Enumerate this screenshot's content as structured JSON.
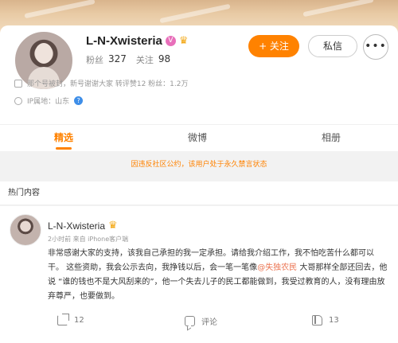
{
  "profile": {
    "username": "L-N-Xwisteria",
    "verified_badge": "V",
    "fans_label": "粉丝",
    "fans_count": "327",
    "following_label": "关注",
    "following_count": "98",
    "follow_button": "+ 关注",
    "message_button": "私信",
    "more_button": "•••",
    "info_line": "那个号被封，新号谢谢大家  转评赞12  粉丝：1.2万",
    "ip_location": "IP属地：山东",
    "help_icon": "?"
  },
  "tabs": [
    {
      "label": "精选",
      "active": true
    },
    {
      "label": "微博",
      "active": false
    },
    {
      "label": "相册",
      "active": false
    }
  ],
  "notice": "因违反社区公约，该用户处于永久禁言状态",
  "section_title": "热门内容",
  "post": {
    "author": "L-N-Xwisteria",
    "meta": "2小时前  来自 iPhone客户端",
    "text_before": "非常感谢大家的支持，该我自己承担的我一定承担。请给我介绍工作，我不怕吃苦什么都可以干。 这些资助，我会公示去向，我挣钱以后，会一笔一笔像",
    "mention": "@失独农民",
    "text_after": " 大哥那样全部还回去，他说 “谁的钱也不是大风刮来的”，他一个失去儿子的民工都能做到，我受过教育的人，没有理由放弃尊严，也要做到。",
    "share_count": "12",
    "comment_label": "评论",
    "like_count": "13"
  },
  "colors": {
    "accent": "#ff8200",
    "mention": "#eb7350",
    "help": "#3e8ee8"
  },
  "icons": [
    "share-icon",
    "comment-icon",
    "like-icon",
    "crown-icon",
    "help-icon"
  ]
}
